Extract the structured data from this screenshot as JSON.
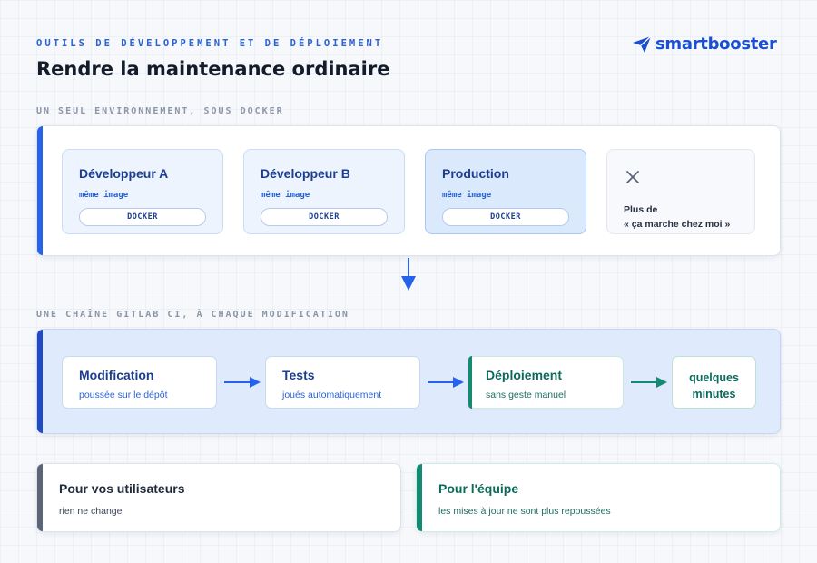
{
  "header": {
    "eyebrow": "OUTILS DE DÉVELOPPEMENT ET DE DÉPLOIEMENT",
    "title": "Rendre la maintenance ordinaire",
    "logo_text": "smartbooster"
  },
  "docker_section": {
    "label": "UN SEUL ENVIRONNEMENT, SOUS DOCKER",
    "cards": [
      {
        "name": "Développeur A",
        "sub": "même image",
        "pill": "DOCKER"
      },
      {
        "name": "Développeur B",
        "sub": "même image",
        "pill": "DOCKER"
      },
      {
        "name": "Production",
        "sub": "même image",
        "pill": "DOCKER"
      }
    ],
    "no_more": {
      "line1": "Plus de",
      "line2": "« ça marche chez moi »"
    }
  },
  "ci_section": {
    "label": "UNE CHAÎNE GITLAB CI, À CHAQUE MODIFICATION",
    "steps": [
      {
        "title": "Modification",
        "sub": "poussée sur le dépôt"
      },
      {
        "title": "Tests",
        "sub": "joués automatiquement"
      },
      {
        "title": "Déploiement",
        "sub": "sans geste manuel"
      }
    ],
    "result_line1": "quelques",
    "result_line2": "minutes"
  },
  "outcomes": [
    {
      "title": "Pour vos utilisateurs",
      "sub": "rien ne change"
    },
    {
      "title": "Pour l'équipe",
      "sub": "les mises à jour ne sont plus repoussées"
    }
  ],
  "colors": {
    "accent_blue": "#2a63d6",
    "accent_green": "#138a72",
    "accent_slate": "#5b6577"
  }
}
